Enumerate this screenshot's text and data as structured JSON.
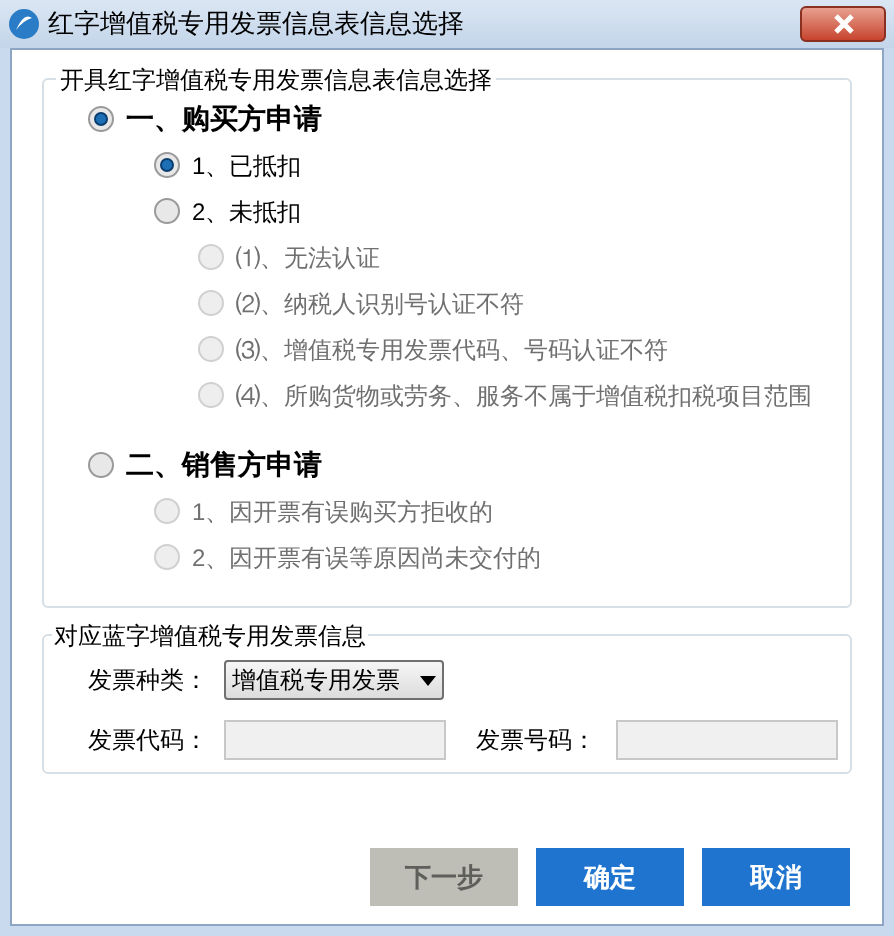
{
  "window": {
    "title": "红字增值税专用发票信息表信息选择"
  },
  "selection_group": {
    "legend": "开具红字增值税专用发票信息表信息选择",
    "options": [
      {
        "label": "一、购买方申请",
        "selected": true,
        "disabled": false,
        "children": [
          {
            "label": "1、已抵扣",
            "selected": true,
            "disabled": false
          },
          {
            "label": "2、未抵扣",
            "selected": false,
            "disabled": false,
            "children": [
              {
                "label": "⑴、无法认证",
                "selected": false,
                "disabled": true
              },
              {
                "label": "⑵、纳税人识别号认证不符",
                "selected": false,
                "disabled": true
              },
              {
                "label": "⑶、增值税专用发票代码、号码认证不符",
                "selected": false,
                "disabled": true
              },
              {
                "label": "⑷、所购货物或劳务、服务不属于增值税扣税项目范围",
                "selected": false,
                "disabled": true
              }
            ]
          }
        ]
      },
      {
        "label": "二、销售方申请",
        "selected": false,
        "disabled": false,
        "children": [
          {
            "label": "1、因开票有误购买方拒收的",
            "selected": false,
            "disabled": true
          },
          {
            "label": "2、因开票有误等原因尚未交付的",
            "selected": false,
            "disabled": true
          }
        ]
      }
    ]
  },
  "invoice_group": {
    "legend": "对应蓝字增值税专用发票信息",
    "type_label": "发票种类：",
    "type_value": "增值税专用发票",
    "code_label": "发票代码：",
    "number_label": "发票号码："
  },
  "buttons": [
    {
      "label": "下一步",
      "disabled": true
    },
    {
      "label": "确定",
      "disabled": false
    },
    {
      "label": "取消",
      "disabled": false
    }
  ]
}
